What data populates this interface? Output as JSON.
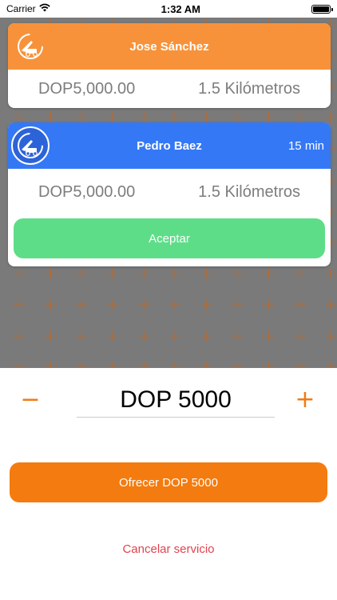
{
  "status_bar": {
    "carrier": "Carrier",
    "time": "1:32 AM"
  },
  "offers": [
    {
      "driver_name": "Jose Sánchez",
      "price": "DOP5,000.00",
      "distance": "1.5 Kilómetros",
      "eta": "",
      "header_color": "#f7923a"
    },
    {
      "driver_name": "Pedro Baez",
      "price": "DOP5,000.00",
      "distance": "1.5 Kilómetros",
      "eta": "15 min",
      "header_color": "#3478f6",
      "accept_label": "Aceptar"
    }
  ],
  "stepper": {
    "minus_symbol": "−",
    "plus_symbol": "+",
    "amount": "DOP 5000"
  },
  "offer_button": "Ofrecer DOP 5000",
  "cancel_link": "Cancelar servicio",
  "colors": {
    "accent_orange": "#f47b0f",
    "accept_green": "#5edd88",
    "cancel_red": "#e0434f",
    "pattern_bg": "#7a7a7a"
  }
}
